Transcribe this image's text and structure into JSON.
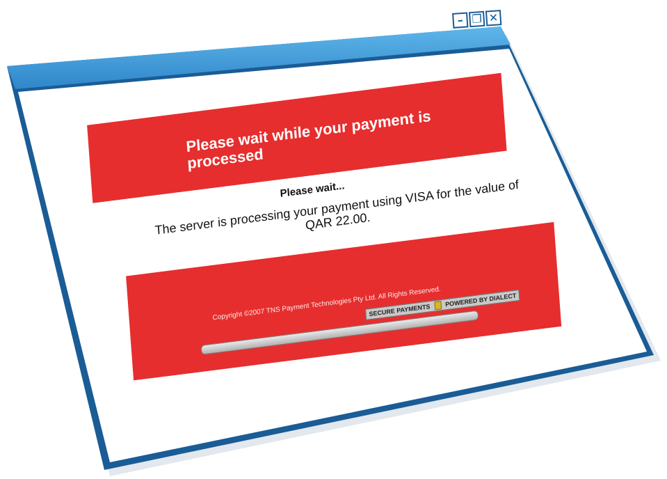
{
  "window": {
    "controls": {
      "minimize_icon": "minimize-icon",
      "restore_icon": "restore-icon",
      "close_icon": "close-icon"
    },
    "colors": {
      "frame": "#1a5c96",
      "titlebar": "#3a9ad9",
      "banner": "#e62e2e"
    }
  },
  "banner": {
    "title": "Please wait while your payment is processed"
  },
  "status": {
    "heading": "Please wait...",
    "message": "The server is processing your payment using VISA for the value of QAR 22.00."
  },
  "footer": {
    "copyright": "Copyright ©2007 TNS Payment Technologies Pty Ltd. All Rights Reserved.",
    "secure_payments": "SECURE PAYMENTS",
    "powered_by": "POWERED BY DIALECT",
    "lock_icon": "lock-icon"
  }
}
